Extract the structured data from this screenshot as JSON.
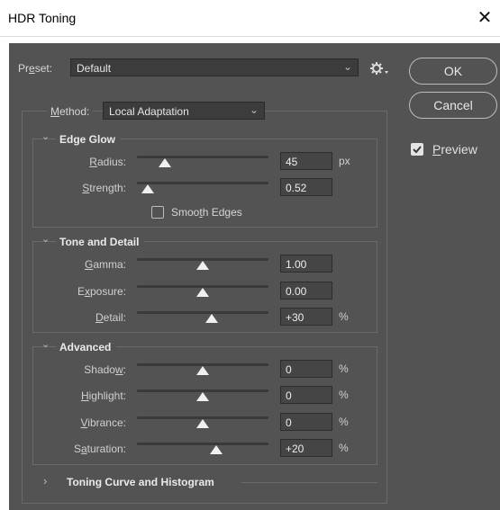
{
  "window": {
    "title": "HDR Toning",
    "close_glyph": "✕"
  },
  "preset": {
    "label_pre": "Pr",
    "label_u": "e",
    "label_post": "set:",
    "value": "Default",
    "menu_icon": "gear-icon"
  },
  "buttons": {
    "ok": "OK",
    "cancel": "Cancel"
  },
  "preview": {
    "label_u": "P",
    "label_rest": "review",
    "checked": true
  },
  "method": {
    "label_u": "M",
    "label_rest": "ethod:",
    "value": "Local Adaptation"
  },
  "edge_glow": {
    "title": "Edge Glow",
    "radius": {
      "label_u": "R",
      "label_rest": "adius:",
      "value": "45",
      "unit": "px",
      "level": 0.21
    },
    "strength": {
      "label_u": "S",
      "label_rest": "trength:",
      "value": "0.52",
      "unit": "",
      "level": 0.08
    },
    "smooth_edges": {
      "label_pre": "Smoo",
      "label_u": "t",
      "label_post": "h Edges",
      "checked": false
    }
  },
  "tone_detail": {
    "title": "Tone and Detail",
    "gamma": {
      "label_u": "G",
      "label_rest": "amma:",
      "value": "1.00",
      "unit": "",
      "level": 0.5
    },
    "exposure": {
      "label_pre": "E",
      "label_u": "x",
      "label_post": "posure:",
      "value": "0.00",
      "unit": "",
      "level": 0.5
    },
    "detail": {
      "label_u": "D",
      "label_rest": "etail:",
      "value": "+30",
      "unit": "%",
      "level": 0.57
    }
  },
  "advanced": {
    "title": "Advanced",
    "shadow": {
      "label_pre": "Shado",
      "label_u": "w",
      "label_post": ":",
      "value": "0",
      "unit": "%",
      "level": 0.5
    },
    "highlight": {
      "label_u": "H",
      "label_rest": "ighlight:",
      "value": "0",
      "unit": "%",
      "level": 0.5
    },
    "vibrance": {
      "label_u": "V",
      "label_rest": "ibrance:",
      "value": "0",
      "unit": "%",
      "level": 0.5
    },
    "saturation": {
      "label_pre": "S",
      "label_u": "a",
      "label_post": "turation:",
      "value": "+20",
      "unit": "%",
      "level": 0.6
    }
  },
  "curve": {
    "title": "Toning Curve and Histogram",
    "caret": "›"
  },
  "carets": {
    "down": "⌄",
    "right": "›"
  }
}
